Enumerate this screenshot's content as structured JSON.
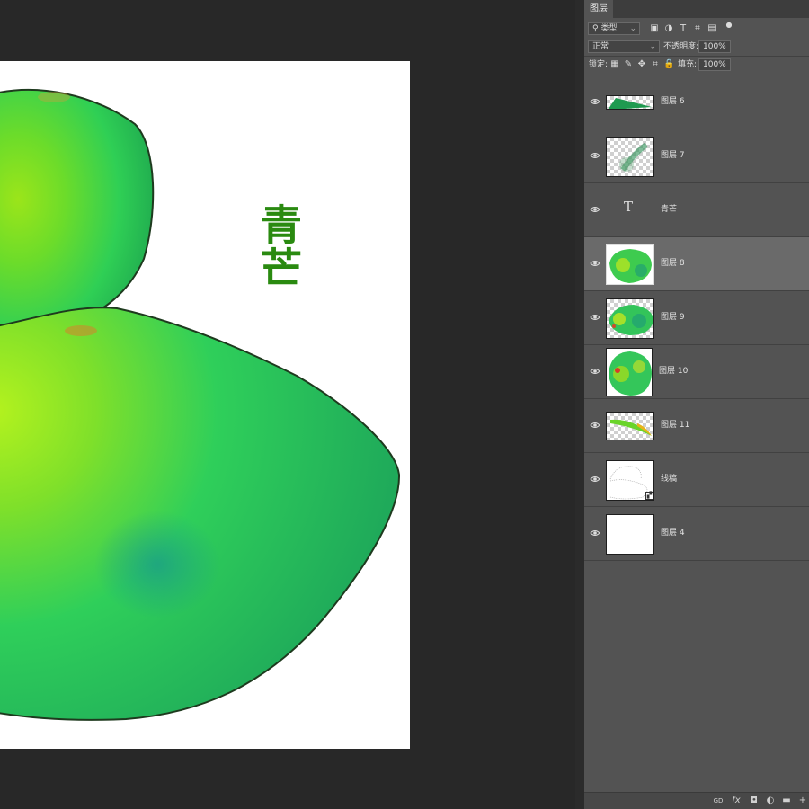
{
  "canvas": {
    "vertical_text": "青芒"
  },
  "panel": {
    "tab_label": "图层",
    "filter": {
      "search_icon": "search-icon",
      "kind_label": "类型",
      "icons": [
        "pixel-filter-icon",
        "adjustment-filter-icon",
        "type-filter-icon",
        "shape-filter-icon",
        "smart-object-filter-icon",
        "filter-toggle-icon"
      ]
    },
    "blend": {
      "mode": "正常",
      "opacity_label": "不透明度:",
      "opacity_value": "100%"
    },
    "lock": {
      "label": "锁定:",
      "icons": [
        "lock-transparency-icon",
        "lock-pixels-icon",
        "lock-position-icon",
        "lock-artboard-icon",
        "lock-all-icon"
      ],
      "fill_label": "填充:",
      "fill_value": "100%"
    },
    "layers": [
      {
        "name": "图层 6",
        "kind": "pixel-transparent",
        "selected": false
      },
      {
        "name": "图层 7",
        "kind": "pixel-transparent",
        "selected": false
      },
      {
        "name": "青芒",
        "kind": "type",
        "selected": false
      },
      {
        "name": "图层 8",
        "kind": "pixel",
        "selected": true
      },
      {
        "name": "图层 9",
        "kind": "pixel-transparent",
        "selected": false
      },
      {
        "name": "图层 10",
        "kind": "pixel",
        "selected": false
      },
      {
        "name": "图层 11",
        "kind": "pixel-transparent",
        "selected": false
      },
      {
        "name": "线稿",
        "kind": "smart-object",
        "selected": false
      },
      {
        "name": "图层 4",
        "kind": "pixel-white",
        "selected": false
      }
    ],
    "footer_icons": [
      "link-layers-icon",
      "layer-style-icon",
      "add-mask-icon",
      "new-adjustment-icon",
      "new-group-icon",
      "new-layer-icon"
    ],
    "footer_glyphs": [
      "GD",
      "fx",
      "◘",
      "◐",
      "▬",
      "+"
    ],
    "colors": {
      "panel_bg": "#535353",
      "selected_row": "#6a6a6a",
      "workspace": "#282828",
      "text_accent": "#2a8a10"
    }
  }
}
